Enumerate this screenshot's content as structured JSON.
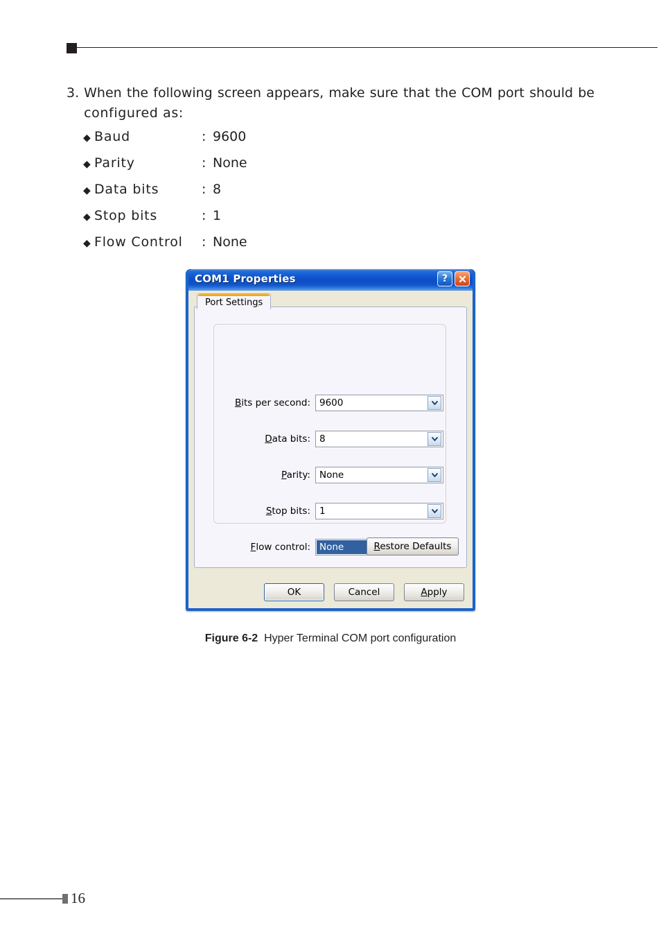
{
  "page": {
    "number": "16"
  },
  "step": {
    "number": "3.",
    "line1": "When  the  following  screen  appears,  make  sure  that  the  COM  port  should  be",
    "line2": "configured as:"
  },
  "settings": {
    "bullet": "◆",
    "colon": ":",
    "items": [
      {
        "label": "Baud",
        "value": "9600"
      },
      {
        "label": "Parity",
        "value": "None"
      },
      {
        "label": "Data bits",
        "value": "8"
      },
      {
        "label": "Stop bits",
        "value": "1"
      },
      {
        "label": "Flow Control",
        "value": "None"
      }
    ]
  },
  "dialog": {
    "title": "COM1 Properties",
    "help_button": "?",
    "close_button": "✕",
    "tab": {
      "label_pre": "Port Settin",
      "label_accel": "g",
      "label_post": "s"
    },
    "fields": [
      {
        "accel": "B",
        "label_pre": "",
        "label_post": "its per second:",
        "value": "9600",
        "selected": false
      },
      {
        "accel": "D",
        "label_pre": "",
        "label_post": "ata bits:",
        "value": "8",
        "selected": false
      },
      {
        "accel": "P",
        "label_pre": "",
        "label_post": "arity:",
        "value": "None",
        "selected": false
      },
      {
        "accel": "S",
        "label_pre": "",
        "label_post": "top bits:",
        "value": "1",
        "selected": false
      },
      {
        "accel": "F",
        "label_pre": "",
        "label_post": "low control:",
        "value": "None",
        "selected": true
      }
    ],
    "restore_defaults": {
      "accel": "R",
      "rest": "estore Defaults"
    },
    "buttons": [
      {
        "label": "OK",
        "default": true
      },
      {
        "label": "Cancel",
        "default": false
      },
      {
        "label_accel": "A",
        "label_rest": "pply",
        "default": false
      }
    ]
  },
  "figure": {
    "number": "Figure 6-2",
    "caption": "Hyper Terminal COM port configuration"
  },
  "colors": {
    "titlebar_blue": "#0d4ec4",
    "dialog_border": "#1c63c8",
    "tab_accent_orange": "#f59d19",
    "selection_blue": "#31619f",
    "close_button_orange": "#ea7338",
    "page_text": "#231f20"
  }
}
